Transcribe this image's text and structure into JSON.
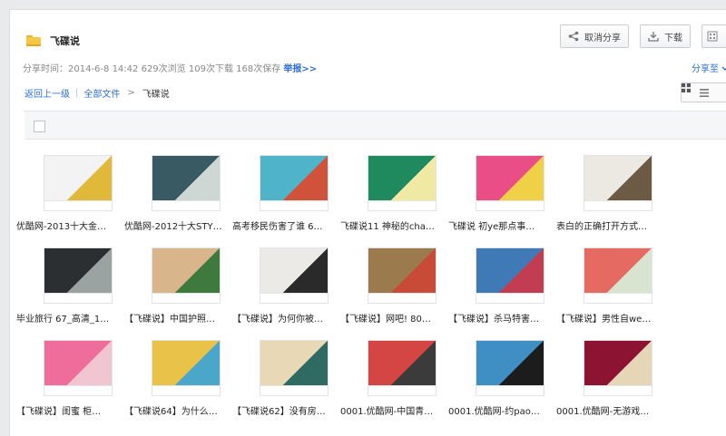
{
  "title": "飞碟说",
  "buttons": {
    "cancel_share": "取消分享",
    "download": "下载"
  },
  "meta": {
    "share_time": "分享时间：2014-6-8 14:42",
    "views": "629次浏览",
    "downloads": "109次下载",
    "saves": "168次保存",
    "report": "举报>>"
  },
  "share_to": "分享至",
  "breadcrumb": {
    "back": "返回上一级",
    "all": "全部文件",
    "current": "飞碟说"
  },
  "items": [
    {
      "caption": "优酷网-2013十大金…",
      "colors": [
        "#f3f3f3",
        "#e0b83a"
      ]
    },
    {
      "caption": "优酷网-2012十大STY…",
      "colors": [
        "#3a5a63",
        "#cfd7d5"
      ]
    },
    {
      "caption": "高考移民伤害了谁 6…",
      "colors": [
        "#4fb4c9",
        "#d0523b"
      ]
    },
    {
      "caption": "飞碟说11 神秘的cha…",
      "colors": [
        "#1f8a5d",
        "#f0e9a3"
      ]
    },
    {
      "caption": "飞碟说 初ye那点事…",
      "colors": [
        "#e94e86",
        "#f0d046"
      ]
    },
    {
      "caption": "表白的正确打开方式…",
      "colors": [
        "#ece9e3",
        "#6d5a44"
      ]
    },
    {
      "caption": "毕业旅行 67_高清_1…",
      "colors": [
        "#2c2f32",
        "#9aa3a1"
      ]
    },
    {
      "caption": "【飞碟说】中国护照…",
      "colors": [
        "#d8b58a",
        "#3e7a3e"
      ]
    },
    {
      "caption": "【飞碟说】为何你被…",
      "colors": [
        "#eceae6",
        "#2a2a2a"
      ]
    },
    {
      "caption": "【飞碟说】网吧! 80…",
      "colors": [
        "#9b7a4e",
        "#c74b36"
      ]
    },
    {
      "caption": "【飞碟说】杀马特害…",
      "colors": [
        "#3f79b6",
        "#c23c52"
      ]
    },
    {
      "caption": "【飞碟说】男性自we…",
      "colors": [
        "#e46a62",
        "#d8e3d0"
      ]
    },
    {
      "caption": "【飞碟说】闺蜜 柜…",
      "colors": [
        "#ee6d9a",
        "#f2c6d0"
      ]
    },
    {
      "caption": "【飞碟说64】为什么…",
      "colors": [
        "#e9c24a",
        "#4aa7c9"
      ]
    },
    {
      "caption": "【飞碟说62】没有房…",
      "colors": [
        "#e9d8b5",
        "#2f6b63"
      ]
    },
    {
      "caption": "0001.优酷网-中国青…",
      "colors": [
        "#d34643",
        "#3b3b3b"
      ]
    },
    {
      "caption": "0001.优酷网-约pao…",
      "colors": [
        "#3f8fc4",
        "#1c1c1c"
      ]
    },
    {
      "caption": "0001.优酷网-无游戏…",
      "colors": [
        "#8c1432",
        "#e6d6b8"
      ]
    }
  ]
}
